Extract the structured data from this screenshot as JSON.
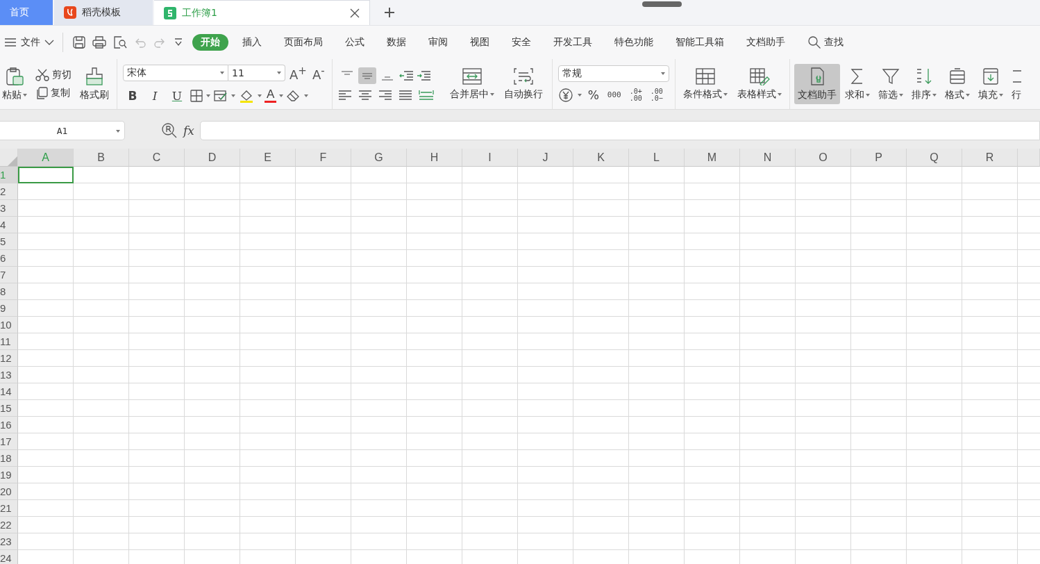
{
  "doc_tabs": [
    {
      "kind": "home",
      "label": "首页",
      "selected": false
    },
    {
      "kind": "docer",
      "label": "稻壳模板",
      "selected": false
    },
    {
      "kind": "sheet",
      "label": "工作簿1",
      "selected": true
    }
  ],
  "menu_bar": {
    "file_menu": "文件",
    "ribbon_tabs": [
      {
        "label": "开始",
        "selected": true
      },
      {
        "label": "插入",
        "selected": false
      },
      {
        "label": "页面布局",
        "selected": false
      },
      {
        "label": "公式",
        "selected": false
      },
      {
        "label": "数据",
        "selected": false
      },
      {
        "label": "审阅",
        "selected": false
      },
      {
        "label": "视图",
        "selected": false
      },
      {
        "label": "安全",
        "selected": false
      },
      {
        "label": "开发工具",
        "selected": false
      },
      {
        "label": "特色功能",
        "selected": false
      },
      {
        "label": "智能工具箱",
        "selected": false
      },
      {
        "label": "文档助手",
        "selected": false
      }
    ],
    "search": "查找"
  },
  "ribbon": {
    "clipboard": {
      "paste": "粘贴",
      "cut": "剪切",
      "copy": "复制",
      "format_painter": "格式刷"
    },
    "font": {
      "font_name": "宋体",
      "font_size": "11",
      "size_buttons": [
        "A$^{+}$",
        "A$^{-}$"
      ],
      "style_buttons": [
        "B",
        "I",
        "U"
      ],
      "font_color": "A"
    },
    "alignment": {
      "vertical_align": [
        {
          "selected": false
        },
        {
          "selected": true
        },
        {
          "selected": false
        }
      ],
      "merge": "合并居中",
      "wrap": "自动换行"
    },
    "number": {
      "format": "常规",
      "percent": "%",
      "thousands": "000",
      "increase_decimal": [
        ".0+",
        ".00"
      ],
      "decrease_decimal": [
        ".00",
        ".0−"
      ]
    },
    "styles": [
      "条件格式",
      "表格样式"
    ],
    "tools": [
      {
        "kind": "assistant",
        "label": "文档助手",
        "selected": true,
        "dropdown": false
      },
      {
        "kind": "sum",
        "label": "求和",
        "selected": false,
        "dropdown": true
      },
      {
        "kind": "filter",
        "label": "筛选",
        "selected": false,
        "dropdown": true
      },
      {
        "kind": "sort",
        "label": "排序",
        "selected": false,
        "dropdown": true
      },
      {
        "kind": "format",
        "label": "格式",
        "selected": false,
        "dropdown": true
      },
      {
        "kind": "fill",
        "label": "填充",
        "selected": false,
        "dropdown": true
      },
      {
        "kind": "row",
        "label": "行",
        "selected": false,
        "dropdown": false
      }
    ]
  },
  "formula_bar": {
    "name_box": "A1",
    "function_label": "fx"
  },
  "sheet": {
    "columns": [
      {
        "label": "A",
        "selected": true
      },
      {
        "label": "B",
        "selected": false
      },
      {
        "label": "C",
        "selected": false
      },
      {
        "label": "D",
        "selected": false
      },
      {
        "label": "E",
        "selected": false
      },
      {
        "label": "F",
        "selected": false
      },
      {
        "label": "G",
        "selected": false
      },
      {
        "label": "H",
        "selected": false
      },
      {
        "label": "I",
        "selected": false
      },
      {
        "label": "J",
        "selected": false
      },
      {
        "label": "K",
        "selected": false
      },
      {
        "label": "L",
        "selected": false
      },
      {
        "label": "M",
        "selected": false
      },
      {
        "label": "N",
        "selected": false
      },
      {
        "label": "O",
        "selected": false
      },
      {
        "label": "P",
        "selected": false
      },
      {
        "label": "Q",
        "selected": false
      },
      {
        "label": "R",
        "selected": false
      }
    ],
    "rows": [
      {
        "label": "1",
        "selected": true
      },
      {
        "label": "2",
        "selected": false
      },
      {
        "label": "3",
        "selected": false
      },
      {
        "label": "4",
        "selected": false
      },
      {
        "label": "5",
        "selected": false
      },
      {
        "label": "6",
        "selected": false
      },
      {
        "label": "7",
        "selected": false
      },
      {
        "label": "8",
        "selected": false
      },
      {
        "label": "9",
        "selected": false
      },
      {
        "label": "10",
        "selected": false
      },
      {
        "label": "11",
        "selected": false
      },
      {
        "label": "12",
        "selected": false
      },
      {
        "label": "13",
        "selected": false
      },
      {
        "label": "14",
        "selected": false
      },
      {
        "label": "15",
        "selected": false
      },
      {
        "label": "16",
        "selected": false
      },
      {
        "label": "17",
        "selected": false
      },
      {
        "label": "18",
        "selected": false
      },
      {
        "label": "19",
        "selected": false
      },
      {
        "label": "20",
        "selected": false
      },
      {
        "label": "21",
        "selected": false
      },
      {
        "label": "22",
        "selected": false
      },
      {
        "label": "23",
        "selected": false
      },
      {
        "label": "24",
        "selected": false
      }
    ]
  }
}
